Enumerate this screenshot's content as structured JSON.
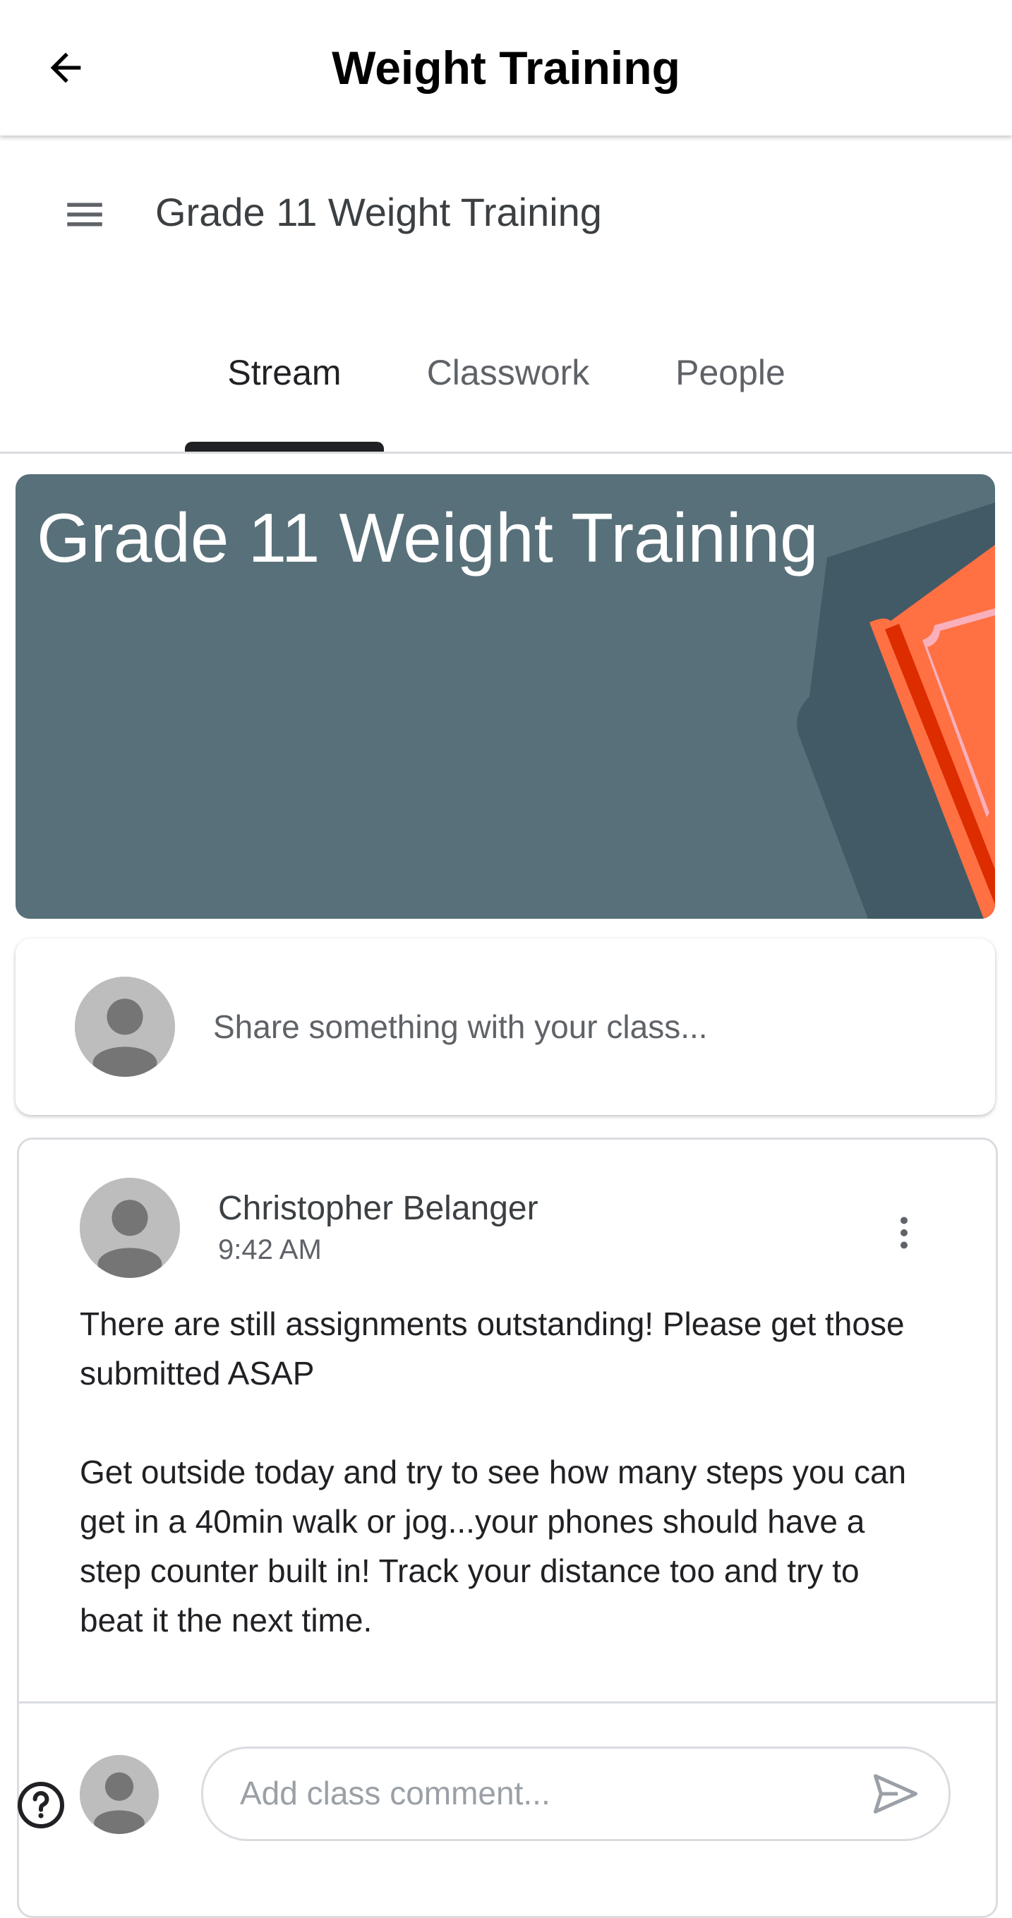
{
  "appbar": {
    "title": "Weight Training",
    "back_icon": "arrow-back-icon"
  },
  "class_header": {
    "menu_icon": "hamburger-menu-icon",
    "name": "Grade 11 Weight Training"
  },
  "tabs": [
    {
      "label": "Stream",
      "active": true
    },
    {
      "label": "Classwork",
      "active": false
    },
    {
      "label": "People",
      "active": false
    }
  ],
  "banner": {
    "title": "Grade 11 Weight Training",
    "color": "#587079",
    "accent_color": "#ff7043"
  },
  "share": {
    "placeholder": "Share something with your class..."
  },
  "post": {
    "author": "Christopher Belanger",
    "time": "9:42 AM",
    "paragraphs": [
      "There are still assignments outstanding! Please get those submitted ASAP",
      "Get outside today and try to see how many steps you can get in a 40min walk or jog...your phones should have a step counter built in! Track your distance too and try to beat it the next time."
    ],
    "more_icon": "more-vertical-icon",
    "comment_placeholder": "Add class comment...",
    "send_icon": "send-icon"
  },
  "help_icon": "help-icon"
}
